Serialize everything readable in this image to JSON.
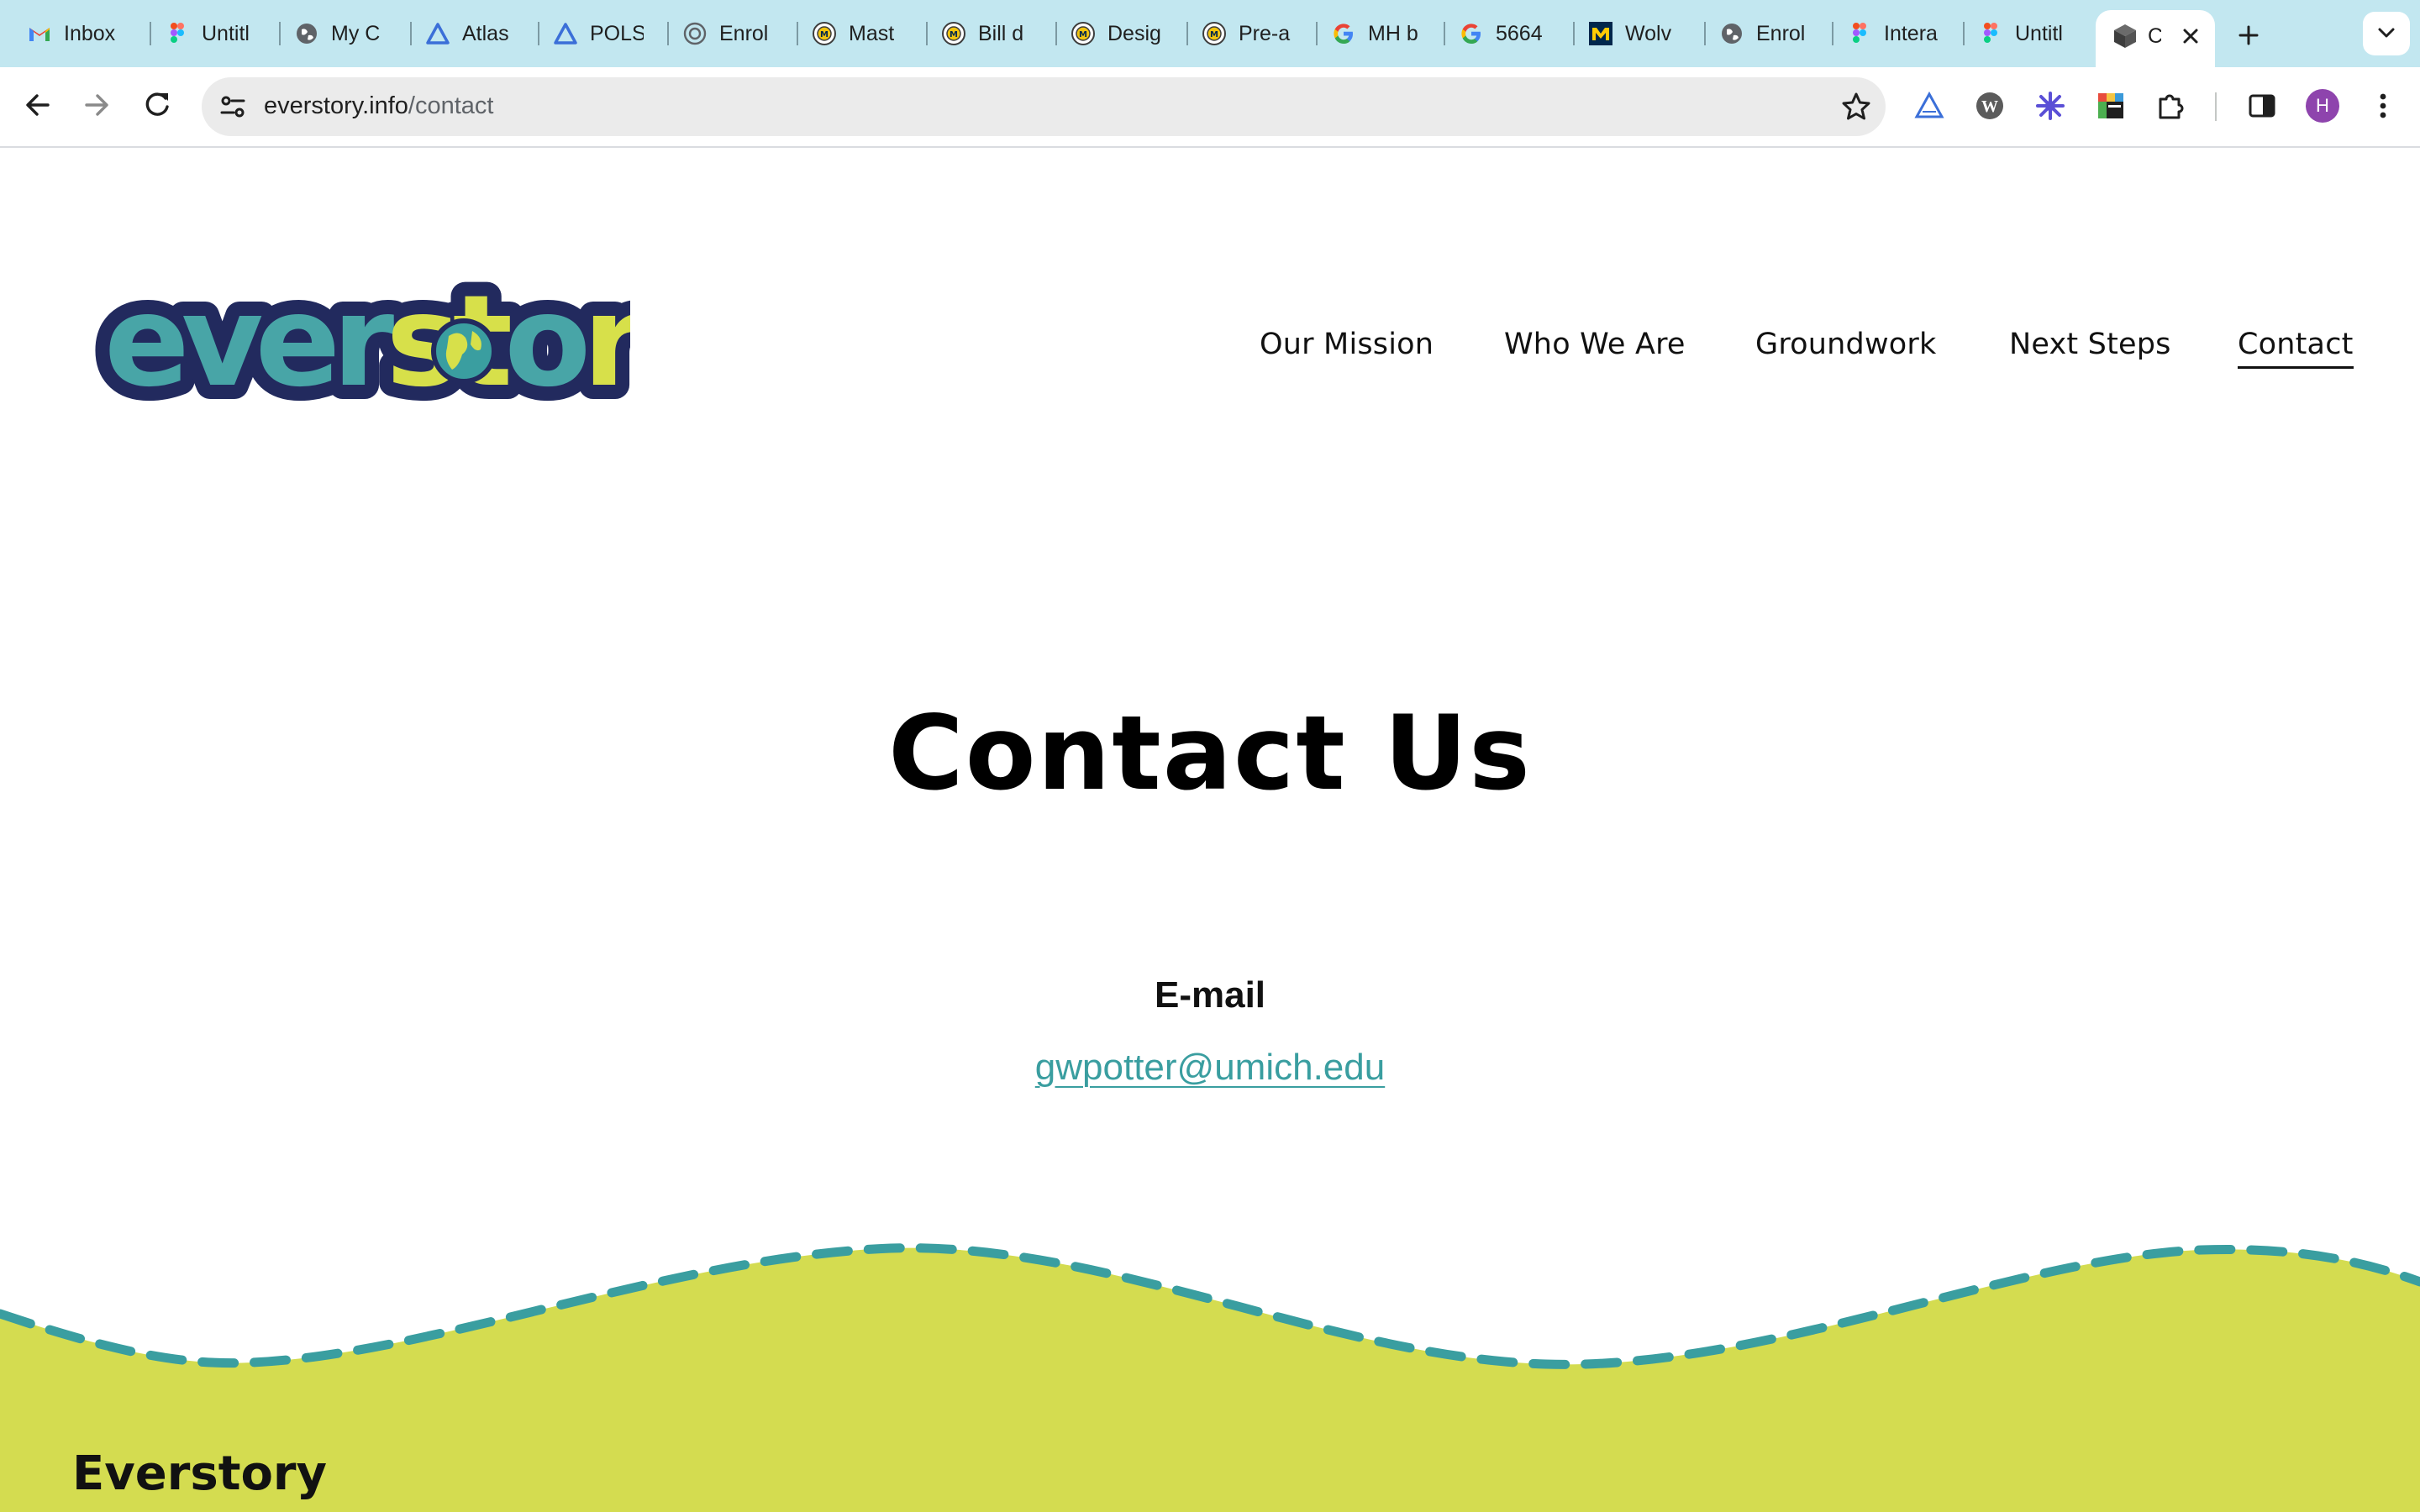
{
  "browser": {
    "tabs": [
      {
        "title": "Inbox",
        "icon": "gmail-icon"
      },
      {
        "title": "Untitl",
        "icon": "figma-icon"
      },
      {
        "title": "My C",
        "icon": "globe-icon"
      },
      {
        "title": "Atlas",
        "icon": "atlas-icon"
      },
      {
        "title": "POLS",
        "icon": "atlas-icon"
      },
      {
        "title": "Enrol",
        "icon": "circle-logo-icon"
      },
      {
        "title": "Mast",
        "icon": "umich-seal-icon"
      },
      {
        "title": "Bill d",
        "icon": "umich-seal-icon"
      },
      {
        "title": "Desig",
        "icon": "umich-seal-icon"
      },
      {
        "title": "Pre-a",
        "icon": "umich-seal-icon"
      },
      {
        "title": "MH b",
        "icon": "google-icon"
      },
      {
        "title": "5664",
        "icon": "google-icon"
      },
      {
        "title": "Wolv",
        "icon": "block-m-icon"
      },
      {
        "title": "Enrol",
        "icon": "globe-icon"
      },
      {
        "title": "Intera",
        "icon": "figma-icon"
      },
      {
        "title": "Untitl",
        "icon": "figma-icon"
      }
    ],
    "active_tab": {
      "title": "C",
      "icon": "cube-icon"
    },
    "url_host": "everstory.info",
    "url_path": "/contact",
    "profile_initial": "H"
  },
  "nav": {
    "items": [
      "Our Mission",
      "Who We Are",
      "Groundwork",
      "Next Steps",
      "Contact"
    ],
    "active": "Contact"
  },
  "logo": {
    "text": "everstory"
  },
  "main": {
    "heading": "Contact Us",
    "email_label": "E-mail",
    "email": "gwpotter@umich.edu"
  },
  "footer": {
    "title": "Everstory"
  },
  "colors": {
    "tabstrip": "#c2e7f0",
    "accent_teal": "#3a9ea0",
    "footer_green": "#d4dc50",
    "logo_navy": "#222a5e",
    "logo_yellow": "#d7e04a"
  }
}
